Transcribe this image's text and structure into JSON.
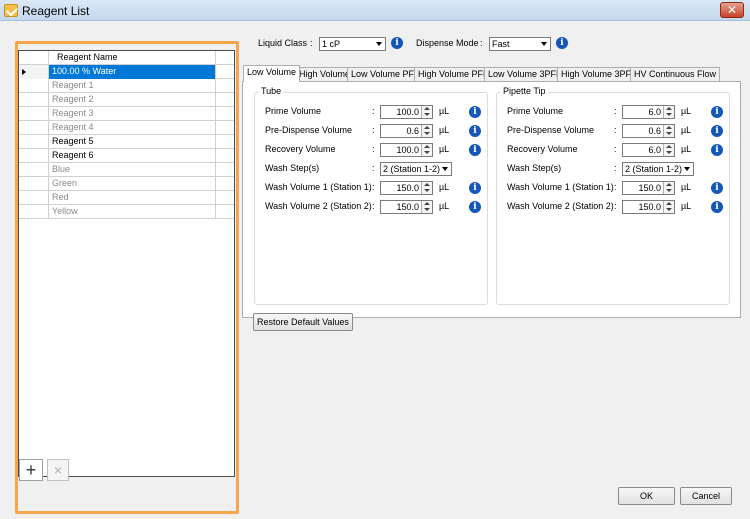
{
  "window": {
    "title": "Reagent List",
    "close_label": "✕"
  },
  "reagents": {
    "header": "Reagent Name",
    "rows": [
      {
        "name": "100.00 % Water"
      },
      {
        "name": "Reagent 1"
      },
      {
        "name": "Reagent 2"
      },
      {
        "name": "Reagent 3"
      },
      {
        "name": "Reagent 4"
      },
      {
        "name": "Reagent 5"
      },
      {
        "name": "Reagent 6"
      },
      {
        "name": "Blue"
      },
      {
        "name": "Green"
      },
      {
        "name": "Red"
      },
      {
        "name": "Yellow"
      }
    ],
    "add_icon": "+",
    "remove_icon": "×"
  },
  "top": {
    "liquid_class_label": "Liquid Class",
    "liquid_class_value": "1 cP",
    "dispense_mode_label": "Dispense Mode",
    "dispense_mode_value": "Fast",
    "colon": ":"
  },
  "tabs": [
    "Low Volume",
    "High Volume",
    "Low Volume PFE",
    "High Volume PFE",
    "Low Volume 3PFE",
    "High Volume 3PFE",
    "HV Continuous Flow"
  ],
  "tube": {
    "title": "Tube",
    "prime_label": "Prime Volume",
    "prime_value": "100.0",
    "predispense_label": "Pre-Dispense Volume",
    "predispense_value": "0.6",
    "recovery_label": "Recovery Volume",
    "recovery_value": "100.0",
    "wash_steps_label": "Wash Step(s)",
    "wash_steps_value": "2 (Station 1-2)",
    "wash1_label": "Wash Volume 1 (Station 1)",
    "wash1_value": "150.0",
    "wash2_label": "Wash Volume 2 (Station 2)",
    "wash2_value": "150.0"
  },
  "tip": {
    "title": "Pipette Tip",
    "prime_label": "Prime Volume",
    "prime_value": "6.0",
    "predispense_label": "Pre-Dispense Volume",
    "predispense_value": "0.6",
    "recovery_label": "Recovery Volume",
    "recovery_value": "6.0",
    "wash_steps_label": "Wash Step(s)",
    "wash_steps_value": "2 (Station 1-2)",
    "wash1_label": "Wash Volume 1 (Station 1)",
    "wash1_value": "150.0",
    "wash2_label": "Wash Volume 2 (Station 2)",
    "wash2_value": "150.0"
  },
  "unit": "µL",
  "info_glyph": "i",
  "buttons": {
    "restore": "Restore Default Values",
    "ok": "OK",
    "cancel": "Cancel"
  },
  "colors": {
    "highlight": "#f7a54a",
    "selection": "#0078d7",
    "info": "#1457b8"
  }
}
